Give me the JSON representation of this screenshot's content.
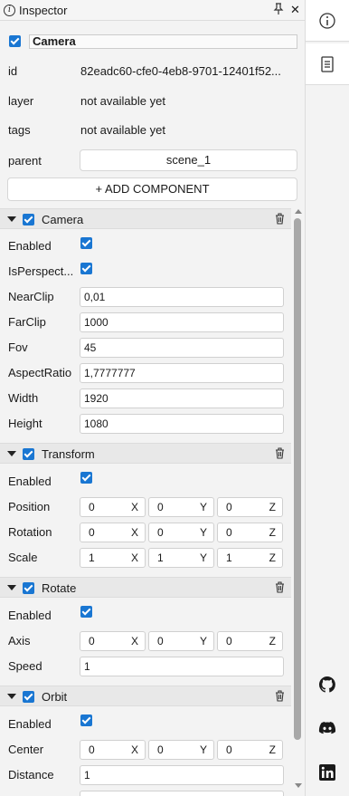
{
  "inspector": {
    "title": "Inspector",
    "entity_name": "Camera",
    "meta": [
      {
        "label": "id",
        "value": "82eadc60-cfe0-4eb8-9701-12401f52..."
      },
      {
        "label": "layer",
        "value": "not available yet"
      },
      {
        "label": "tags",
        "value": "not available yet"
      },
      {
        "label": "parent",
        "value": "scene_1"
      }
    ],
    "add_component": "+ ADD COMPONENT"
  },
  "components": {
    "camera": {
      "name": "Camera",
      "fields": {
        "enabled": "Enabled",
        "perspective": "IsPerspect...",
        "nearclip_label": "NearClip",
        "nearclip": "0,01",
        "farclip_label": "FarClip",
        "farclip": "1000",
        "fov_label": "Fov",
        "fov": "45",
        "aspect_label": "AspectRatio",
        "aspect": "1,7777777",
        "width_label": "Width",
        "width": "1920",
        "height_label": "Height",
        "height": "1080"
      }
    },
    "transform": {
      "name": "Transform",
      "enabled": "Enabled",
      "position_label": "Position",
      "position": [
        "0",
        "0",
        "0"
      ],
      "rotation_label": "Rotation",
      "rotation": [
        "0",
        "0",
        "0"
      ],
      "scale_label": "Scale",
      "scale": [
        "1",
        "1",
        "1"
      ]
    },
    "rotate": {
      "name": "Rotate",
      "enabled": "Enabled",
      "axis_label": "Axis",
      "axis": [
        "0",
        "0",
        "0"
      ],
      "speed_label": "Speed",
      "speed": "1"
    },
    "orbit": {
      "name": "Orbit",
      "enabled": "Enabled",
      "center_label": "Center",
      "center": [
        "0",
        "0",
        "0"
      ],
      "distance_label": "Distance",
      "distance": "1"
    }
  },
  "axes": [
    "X",
    "Y",
    "Z"
  ],
  "sidebar": {
    "tabs": [
      "info-icon",
      "document-icon"
    ],
    "links": [
      "github-icon",
      "discord-icon",
      "linkedin-icon"
    ]
  },
  "colors": {
    "accent": "#1976d2"
  }
}
